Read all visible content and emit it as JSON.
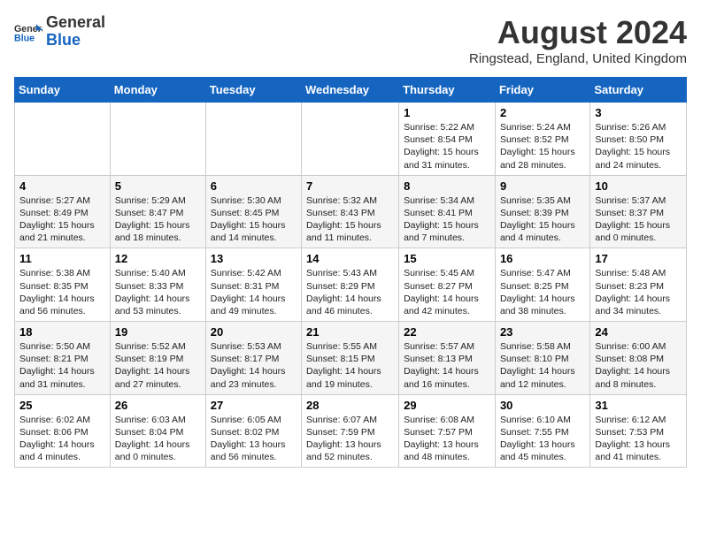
{
  "logo": {
    "general": "General",
    "blue": "Blue"
  },
  "header": {
    "month_year": "August 2024",
    "location": "Ringstead, England, United Kingdom"
  },
  "weekdays": [
    "Sunday",
    "Monday",
    "Tuesday",
    "Wednesday",
    "Thursday",
    "Friday",
    "Saturday"
  ],
  "weeks": [
    [
      {
        "day": "",
        "info": ""
      },
      {
        "day": "",
        "info": ""
      },
      {
        "day": "",
        "info": ""
      },
      {
        "day": "",
        "info": ""
      },
      {
        "day": "1",
        "info": "Sunrise: 5:22 AM\nSunset: 8:54 PM\nDaylight: 15 hours\nand 31 minutes."
      },
      {
        "day": "2",
        "info": "Sunrise: 5:24 AM\nSunset: 8:52 PM\nDaylight: 15 hours\nand 28 minutes."
      },
      {
        "day": "3",
        "info": "Sunrise: 5:26 AM\nSunset: 8:50 PM\nDaylight: 15 hours\nand 24 minutes."
      }
    ],
    [
      {
        "day": "4",
        "info": "Sunrise: 5:27 AM\nSunset: 8:49 PM\nDaylight: 15 hours\nand 21 minutes."
      },
      {
        "day": "5",
        "info": "Sunrise: 5:29 AM\nSunset: 8:47 PM\nDaylight: 15 hours\nand 18 minutes."
      },
      {
        "day": "6",
        "info": "Sunrise: 5:30 AM\nSunset: 8:45 PM\nDaylight: 15 hours\nand 14 minutes."
      },
      {
        "day": "7",
        "info": "Sunrise: 5:32 AM\nSunset: 8:43 PM\nDaylight: 15 hours\nand 11 minutes."
      },
      {
        "day": "8",
        "info": "Sunrise: 5:34 AM\nSunset: 8:41 PM\nDaylight: 15 hours\nand 7 minutes."
      },
      {
        "day": "9",
        "info": "Sunrise: 5:35 AM\nSunset: 8:39 PM\nDaylight: 15 hours\nand 4 minutes."
      },
      {
        "day": "10",
        "info": "Sunrise: 5:37 AM\nSunset: 8:37 PM\nDaylight: 15 hours\nand 0 minutes."
      }
    ],
    [
      {
        "day": "11",
        "info": "Sunrise: 5:38 AM\nSunset: 8:35 PM\nDaylight: 14 hours\nand 56 minutes."
      },
      {
        "day": "12",
        "info": "Sunrise: 5:40 AM\nSunset: 8:33 PM\nDaylight: 14 hours\nand 53 minutes."
      },
      {
        "day": "13",
        "info": "Sunrise: 5:42 AM\nSunset: 8:31 PM\nDaylight: 14 hours\nand 49 minutes."
      },
      {
        "day": "14",
        "info": "Sunrise: 5:43 AM\nSunset: 8:29 PM\nDaylight: 14 hours\nand 46 minutes."
      },
      {
        "day": "15",
        "info": "Sunrise: 5:45 AM\nSunset: 8:27 PM\nDaylight: 14 hours\nand 42 minutes."
      },
      {
        "day": "16",
        "info": "Sunrise: 5:47 AM\nSunset: 8:25 PM\nDaylight: 14 hours\nand 38 minutes."
      },
      {
        "day": "17",
        "info": "Sunrise: 5:48 AM\nSunset: 8:23 PM\nDaylight: 14 hours\nand 34 minutes."
      }
    ],
    [
      {
        "day": "18",
        "info": "Sunrise: 5:50 AM\nSunset: 8:21 PM\nDaylight: 14 hours\nand 31 minutes."
      },
      {
        "day": "19",
        "info": "Sunrise: 5:52 AM\nSunset: 8:19 PM\nDaylight: 14 hours\nand 27 minutes."
      },
      {
        "day": "20",
        "info": "Sunrise: 5:53 AM\nSunset: 8:17 PM\nDaylight: 14 hours\nand 23 minutes."
      },
      {
        "day": "21",
        "info": "Sunrise: 5:55 AM\nSunset: 8:15 PM\nDaylight: 14 hours\nand 19 minutes."
      },
      {
        "day": "22",
        "info": "Sunrise: 5:57 AM\nSunset: 8:13 PM\nDaylight: 14 hours\nand 16 minutes."
      },
      {
        "day": "23",
        "info": "Sunrise: 5:58 AM\nSunset: 8:10 PM\nDaylight: 14 hours\nand 12 minutes."
      },
      {
        "day": "24",
        "info": "Sunrise: 6:00 AM\nSunset: 8:08 PM\nDaylight: 14 hours\nand 8 minutes."
      }
    ],
    [
      {
        "day": "25",
        "info": "Sunrise: 6:02 AM\nSunset: 8:06 PM\nDaylight: 14 hours\nand 4 minutes."
      },
      {
        "day": "26",
        "info": "Sunrise: 6:03 AM\nSunset: 8:04 PM\nDaylight: 14 hours\nand 0 minutes."
      },
      {
        "day": "27",
        "info": "Sunrise: 6:05 AM\nSunset: 8:02 PM\nDaylight: 13 hours\nand 56 minutes."
      },
      {
        "day": "28",
        "info": "Sunrise: 6:07 AM\nSunset: 7:59 PM\nDaylight: 13 hours\nand 52 minutes."
      },
      {
        "day": "29",
        "info": "Sunrise: 6:08 AM\nSunset: 7:57 PM\nDaylight: 13 hours\nand 48 minutes."
      },
      {
        "day": "30",
        "info": "Sunrise: 6:10 AM\nSunset: 7:55 PM\nDaylight: 13 hours\nand 45 minutes."
      },
      {
        "day": "31",
        "info": "Sunrise: 6:12 AM\nSunset: 7:53 PM\nDaylight: 13 hours\nand 41 minutes."
      }
    ]
  ]
}
